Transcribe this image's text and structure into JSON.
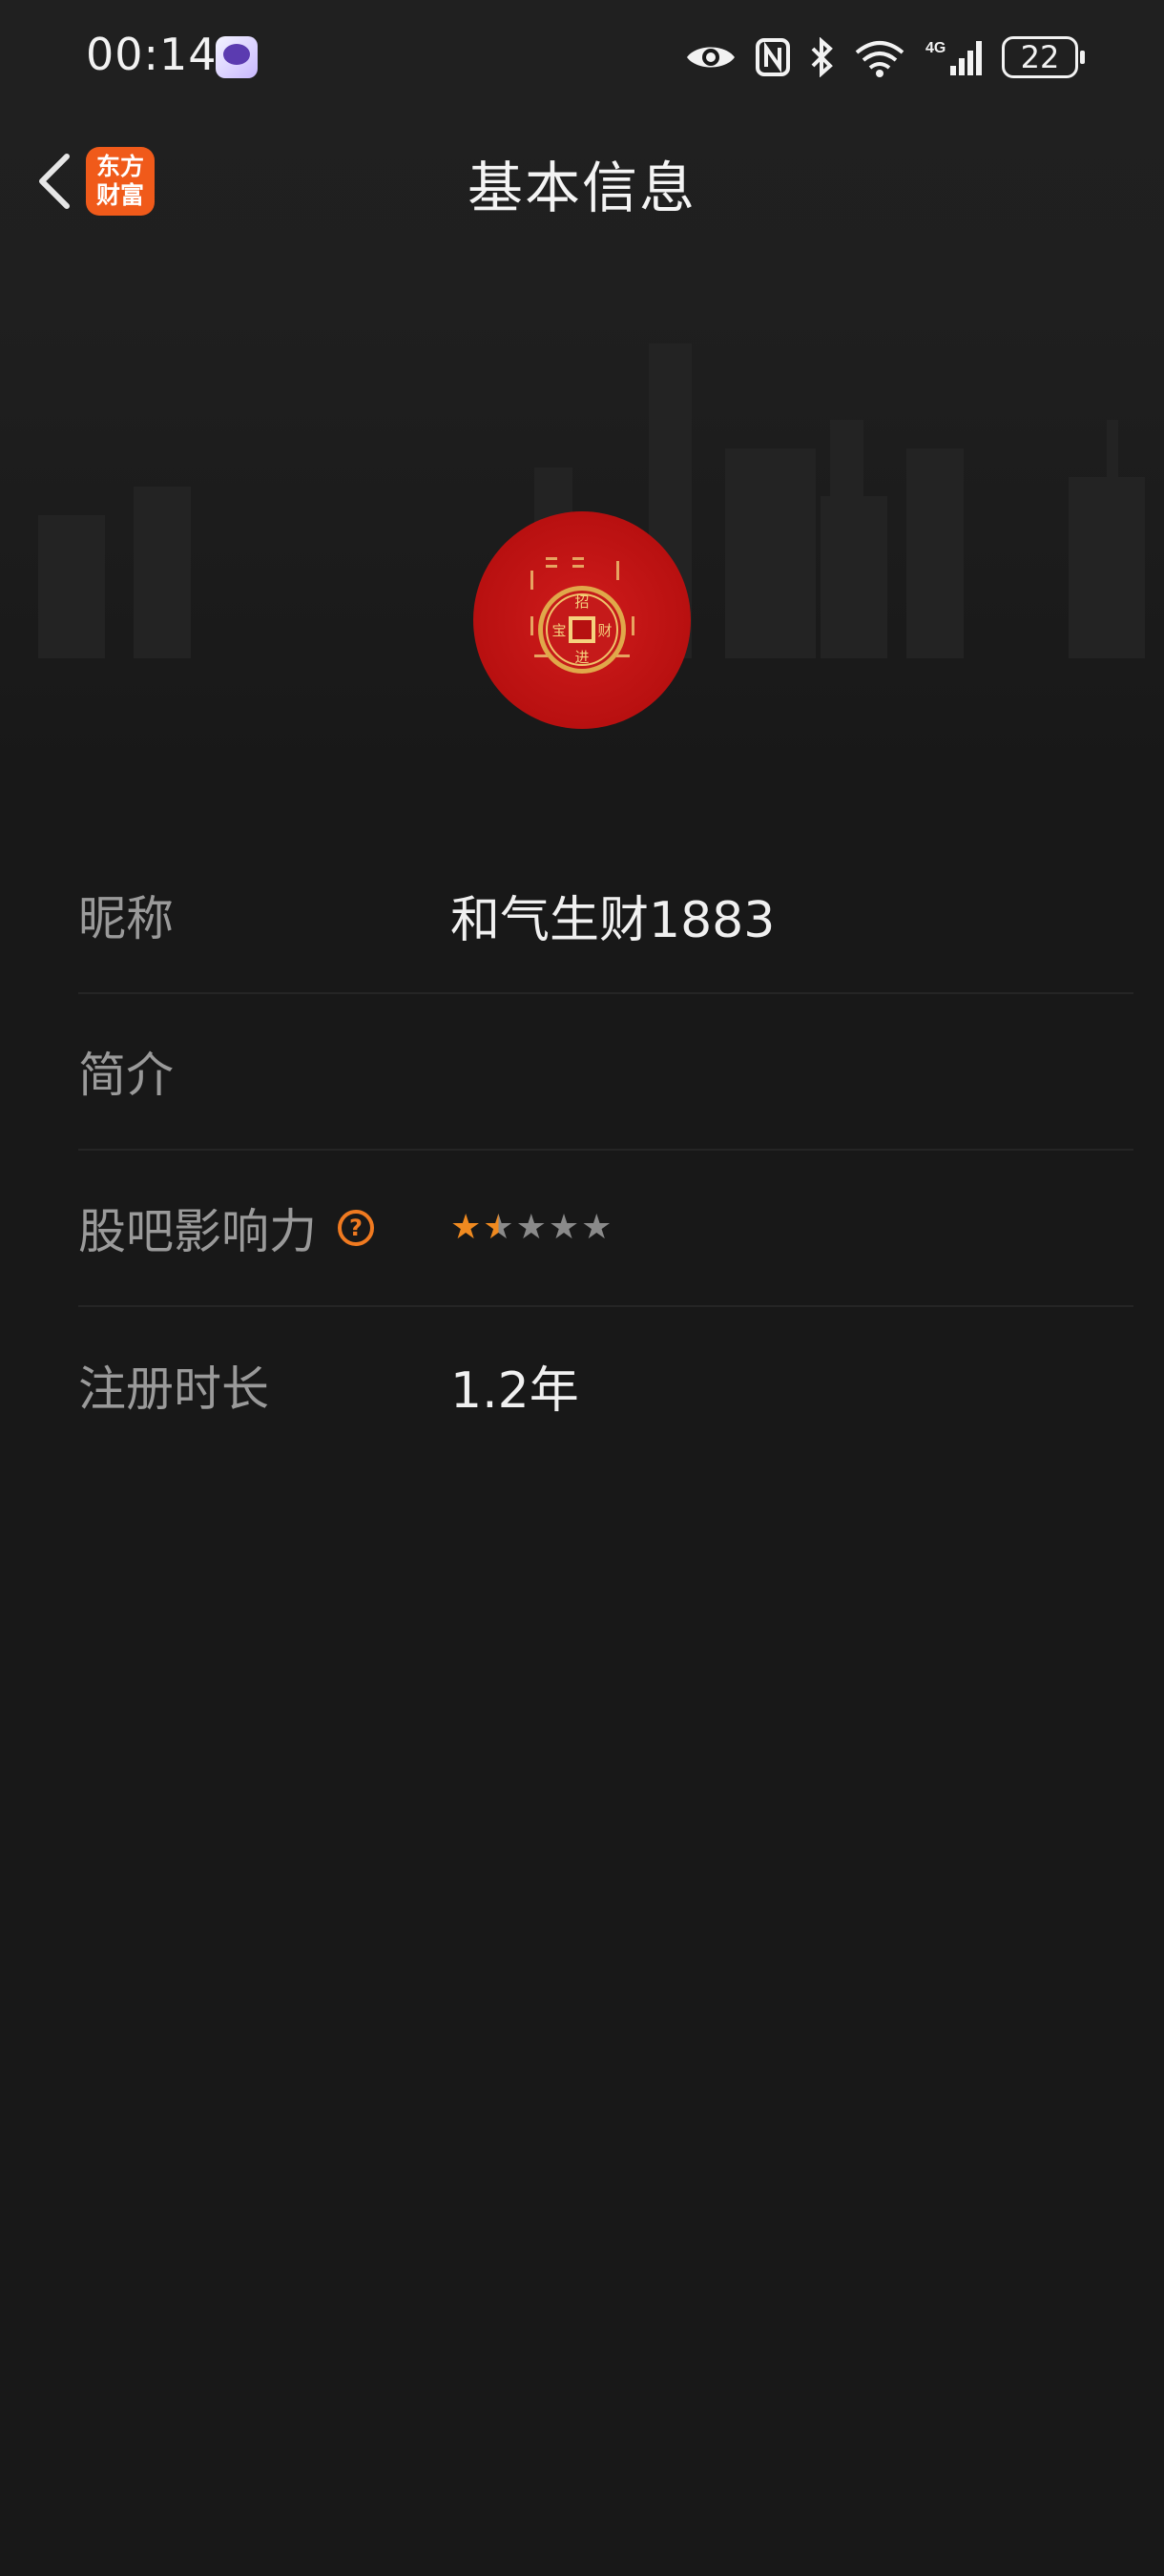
{
  "status_bar": {
    "time": "00:14",
    "icons": [
      "eye-icon",
      "nfc-icon",
      "bluetooth-icon",
      "wifi-icon",
      "signal-4g-icon"
    ],
    "battery": "22"
  },
  "nav": {
    "back_icon": "chevron-left-icon",
    "app_badge_line1": "东方",
    "app_badge_line2": "财富",
    "title": "基本信息"
  },
  "avatar": {
    "coin_chars": [
      "招",
      "财",
      "进",
      "宝"
    ]
  },
  "info": {
    "nickname_label": "昵称",
    "nickname_value": "和气生财1883",
    "intro_label": "简介",
    "intro_value": "",
    "influence_label": "股吧影响力",
    "influence_help_icon": "question-circle-icon",
    "influence_help_glyph": "?",
    "influence_rating": 1.5,
    "influence_rating_max": 5,
    "registration_label": "注册时长",
    "registration_value": "1.2年"
  },
  "colors": {
    "background": "#181818",
    "accent": "#f07a20",
    "brand": "#f05a1a",
    "avatar_red": "#c41414"
  }
}
